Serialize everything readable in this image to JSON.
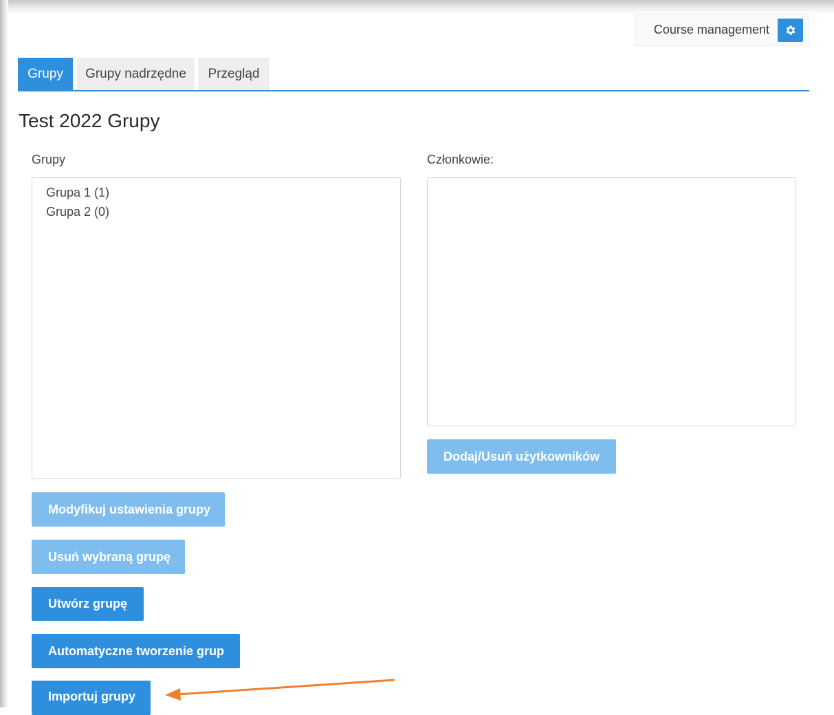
{
  "header": {
    "course_management_label": "Course management",
    "gear_icon": "gear-icon"
  },
  "tabs": [
    {
      "label": "Grupy",
      "active": true
    },
    {
      "label": "Grupy nadrzędne",
      "active": false
    },
    {
      "label": "Przegląd",
      "active": false
    }
  ],
  "page_title": "Test 2022 Grupy",
  "groups": {
    "label": "Grupy",
    "items": [
      "Grupa 1 (1)",
      "Grupa 2 (0)"
    ]
  },
  "members": {
    "label": "Członkowie:",
    "items": []
  },
  "buttons": {
    "add_remove_users": "Dodaj/Usuń użytkowników",
    "edit_group_settings": "Modyfikuj ustawienia grupy",
    "delete_selected_group": "Usuń wybraną grupę",
    "create_group": "Utwórz grupę",
    "auto_create_groups": "Automatyczne tworzenie grup",
    "import_groups": "Importuj grupy"
  },
  "colors": {
    "accent": "#2f8fdf",
    "accent_disabled": "#7fbdee",
    "annotation_arrow": "#f08030"
  }
}
